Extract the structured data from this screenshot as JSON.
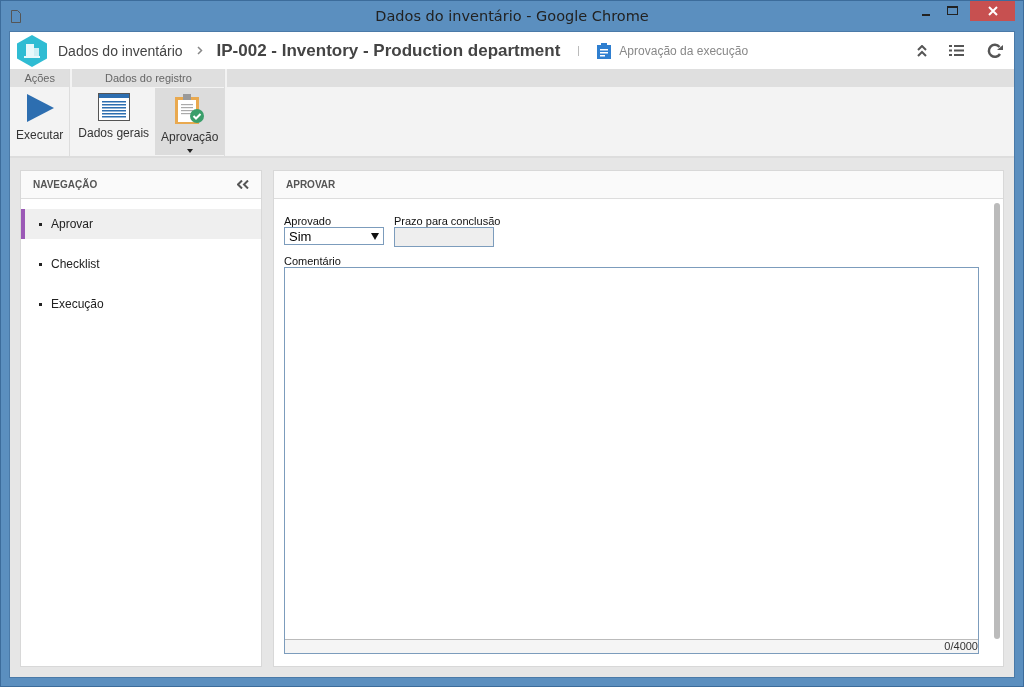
{
  "window": {
    "title": "Dados do inventário - Google Chrome"
  },
  "header": {
    "breadcrumb": "Dados do inventário",
    "title": "IP-002 - Inventory - Production department",
    "subtitle": "Aprovação da execução"
  },
  "ribbon": {
    "groups": [
      {
        "label": "Ações",
        "buttons": [
          {
            "label": "Executar",
            "kind": "play",
            "selected": false,
            "dropdown": false
          }
        ]
      },
      {
        "label": "Dados do registro",
        "buttons": [
          {
            "label": "Dados gerais",
            "kind": "form",
            "selected": false,
            "dropdown": false
          },
          {
            "label": "Aprovação",
            "kind": "clipboard",
            "selected": true,
            "dropdown": true
          }
        ]
      }
    ]
  },
  "navigation": {
    "title": "NAVEGAÇÃO",
    "items": [
      {
        "label": "Aprovar",
        "selected": true
      },
      {
        "label": "Checklist",
        "selected": false
      },
      {
        "label": "Execução",
        "selected": false
      }
    ]
  },
  "form": {
    "title": "APROVAR",
    "approved": {
      "label": "Aprovado",
      "value": "Sim"
    },
    "deadline": {
      "label": "Prazo para conclusão",
      "disabled": true
    },
    "comment": {
      "label": "Comentário",
      "counter": "0/4000"
    }
  }
}
